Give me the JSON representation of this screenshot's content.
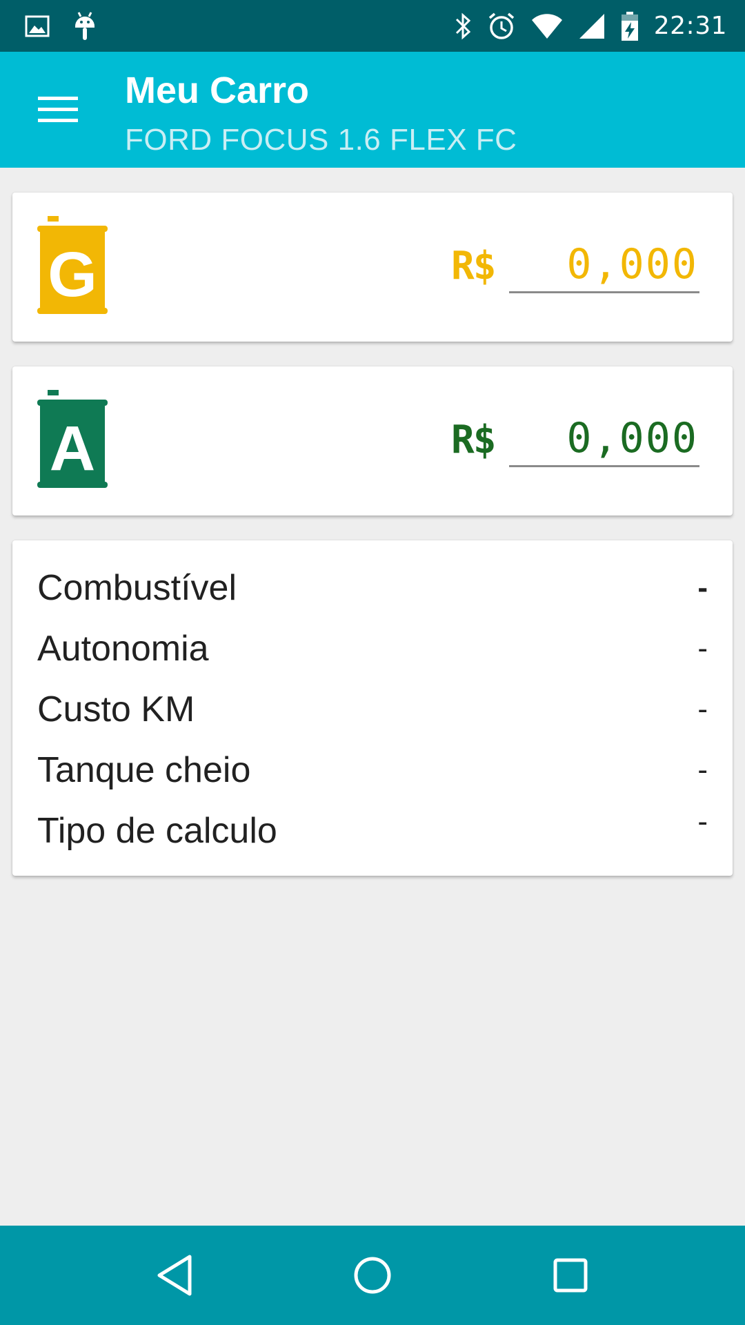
{
  "status_bar": {
    "time": "22:31",
    "icons_left": [
      "image-icon",
      "android-debug-icon"
    ],
    "icons_right": [
      "bluetooth-icon",
      "alarm-icon",
      "wifi-icon",
      "cell-signal-icon",
      "battery-charging-icon"
    ]
  },
  "app_bar": {
    "title": "Meu Carro",
    "subtitle": "FORD FOCUS 1.6 FLEX FC",
    "color": "#00bcd4"
  },
  "gasoline": {
    "icon_letter": "G",
    "currency": "R$",
    "price_placeholder": "0,000",
    "color": "#f2b705"
  },
  "alcohol": {
    "icon_letter": "A",
    "currency": "R$",
    "price_placeholder": "0,000",
    "color": "#1b6b22"
  },
  "info": {
    "rows": [
      {
        "label": "Combustível",
        "value": "-"
      },
      {
        "label": "Autonomia",
        "value": "-"
      },
      {
        "label": "Custo KM",
        "value": "-"
      },
      {
        "label": "Tanque cheio",
        "value": "-"
      },
      {
        "label": "Tipo de calculo",
        "value": "-"
      }
    ]
  },
  "nav_bar": {
    "buttons": [
      "back-icon",
      "home-icon",
      "recents-icon"
    ]
  }
}
